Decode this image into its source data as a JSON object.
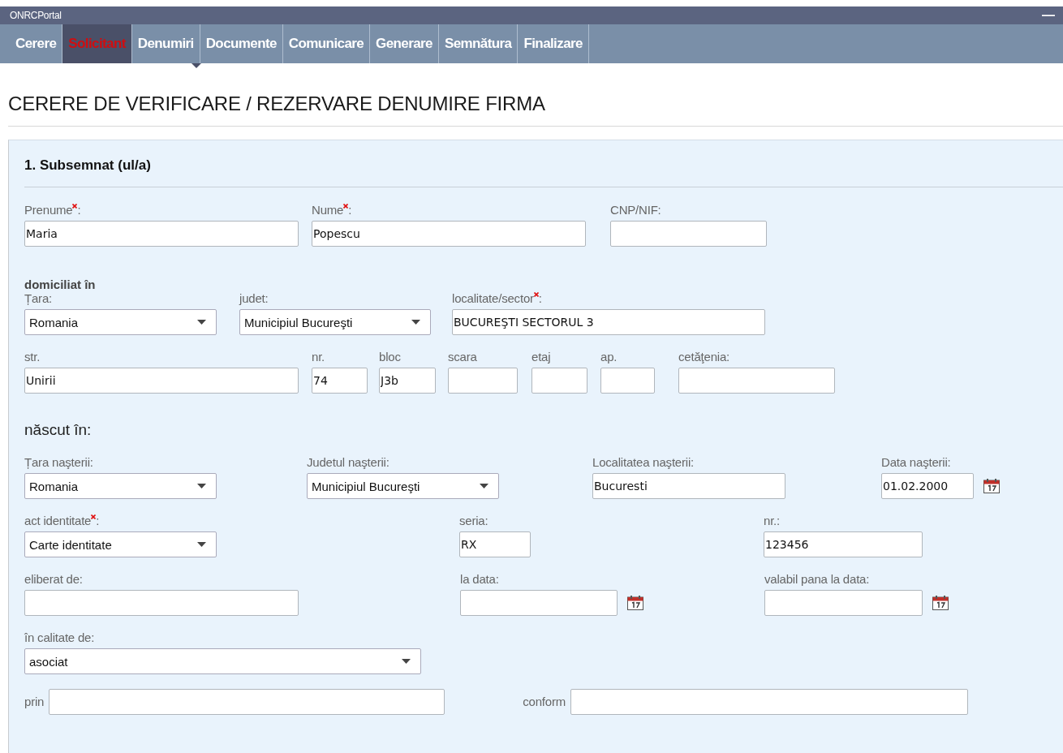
{
  "window": {
    "title": "ONRCPortal",
    "buttons": [
      "—"
    ]
  },
  "tabs": [
    {
      "label": "Cerere",
      "selected": false
    },
    {
      "label": "Solicitant",
      "selected": true
    },
    {
      "label": "Denumiri",
      "selected": false
    },
    {
      "label": "Documente",
      "selected": false
    },
    {
      "label": "Comunicare",
      "selected": false
    },
    {
      "label": "Generare",
      "selected": false
    },
    {
      "label": "Semnătura",
      "selected": false
    },
    {
      "label": "Finalizare",
      "selected": false
    }
  ],
  "page_title": "CERERE DE VERIFICARE / REZERVARE DENUMIRE FIRMA",
  "section": {
    "title": "1. Subsemnat (ul/a)",
    "groups": [
      {
        "rows": [
          {
            "fields": [
              {
                "kind": "text",
                "label": "Prenume",
                "required": true,
                "label_suffix": ":",
                "value": "Maria"
              },
              {
                "kind": "text",
                "label": "Nume",
                "required": true,
                "label_suffix": ":",
                "value": "Popescu"
              },
              {
                "kind": "text",
                "label": "CNP/NIF:",
                "required": false
              }
            ]
          }
        ]
      },
      {
        "heading": "domiciliat în",
        "rows": [
          {
            "fields": [
              {
                "kind": "select",
                "label": "Țara:",
                "required": false,
                "value": "Romania"
              },
              {
                "kind": "select",
                "label": "judet:",
                "required": false,
                "value": "Municipiul Bucureşti"
              },
              {
                "kind": "text",
                "label": "localitate/sector",
                "required": true,
                "label_suffix": ":",
                "value": "BUCUREŞTI SECTORUL 3"
              }
            ]
          },
          {
            "fields": [
              {
                "kind": "text",
                "label": "str.",
                "required": false,
                "value": "Unirii"
              },
              {
                "kind": "text",
                "label": "nr.",
                "required": false,
                "value": "74"
              },
              {
                "kind": "text",
                "label": "bloc",
                "required": false,
                "value": "J3b"
              },
              {
                "kind": "text",
                "label": "scara",
                "required": false
              },
              {
                "kind": "text",
                "label": "etaj",
                "required": false
              },
              {
                "kind": "text",
                "label": "ap.",
                "required": false
              },
              {
                "kind": "text",
                "label": "cetăţenia:",
                "required": false
              }
            ]
          }
        ]
      },
      {
        "heading": "născut în:",
        "rows": [
          {
            "fields": [
              {
                "kind": "select",
                "label": "Țara naşterii:",
                "required": false,
                "value": "Romania"
              },
              {
                "kind": "select",
                "label": "Judetul naşterii:",
                "required": false,
                "value": "Municipiul Bucureşti"
              },
              {
                "kind": "text",
                "label": "Localitatea naşterii:",
                "required": false,
                "value": "Bucuresti"
              },
              {
                "kind": "date",
                "label": "Data naşterii:",
                "required": false,
                "value": "01.02.2000"
              }
            ]
          },
          {
            "fields": [
              {
                "kind": "select",
                "label": "act identitate",
                "required": true,
                "label_suffix": ":",
                "value": "Carte identitate"
              },
              {
                "kind": "text",
                "label": "seria:",
                "required": false,
                "value": "RX"
              },
              {
                "kind": "text",
                "label": "nr.:",
                "required": false,
                "value": "123456"
              }
            ]
          },
          {
            "fields": [
              {
                "kind": "text",
                "label": "eliberat de:",
                "required": false
              },
              {
                "kind": "date",
                "label": "la data:",
                "required": false
              },
              {
                "kind": "date",
                "label": "valabil pana la data:",
                "required": false
              }
            ]
          },
          {
            "fields": [
              {
                "kind": "select",
                "label": "în calitate de:",
                "required": false,
                "value": "asociat"
              }
            ]
          },
          {
            "inline": true,
            "fields": [
              {
                "kind": "text",
                "label": "prin",
                "required": false
              },
              {
                "kind": "text",
                "label": "conform",
                "required": false
              }
            ]
          }
        ]
      }
    ]
  }
}
